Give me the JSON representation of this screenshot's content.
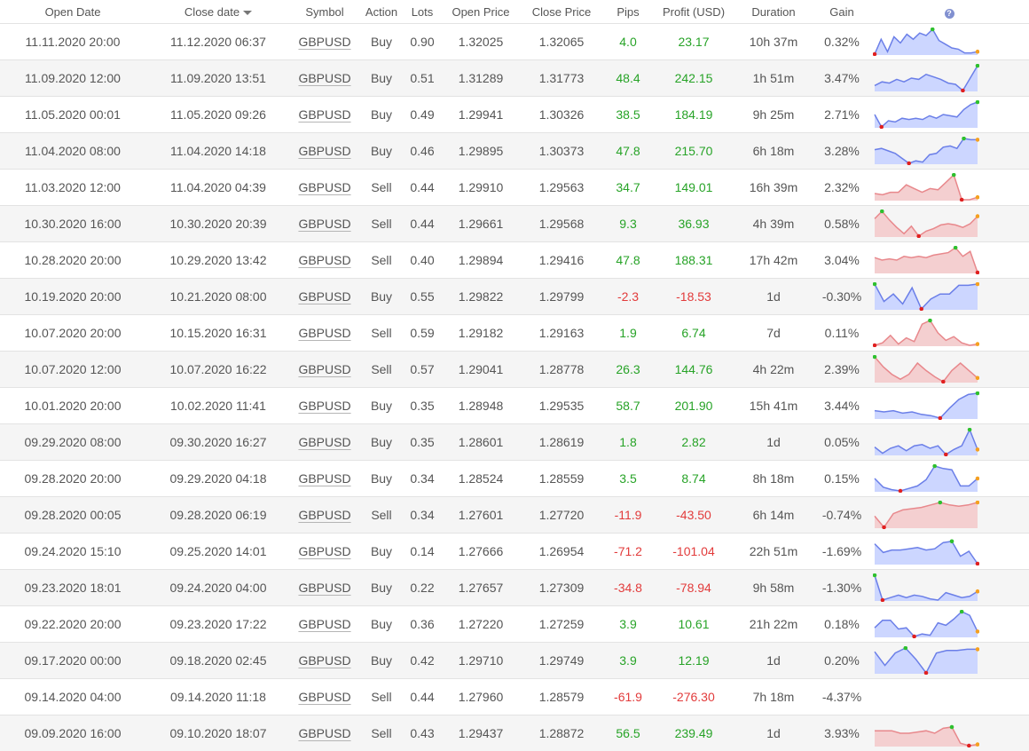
{
  "table": {
    "headers": {
      "open_date": "Open Date",
      "close_date": "Close date",
      "symbol": "Symbol",
      "action": "Action",
      "lots": "Lots",
      "open_price": "Open Price",
      "close_price": "Close Price",
      "pips": "Pips",
      "profit": "Profit (USD)",
      "duration": "Duration",
      "gain": "Gain",
      "help": "?"
    },
    "rows": [
      {
        "open_date": "11.11.2020 20:00",
        "close_date": "11.12.2020 06:37",
        "symbol": "GBPUSD",
        "action": "Buy",
        "lots": "0.90",
        "open_price": "1.32025",
        "close_price": "1.32065",
        "pips": "4.0",
        "profit": "23.17",
        "duration": "10h 37m",
        "gain": "0.32%",
        "trend": [
          0.0,
          0.6,
          0.1,
          0.7,
          0.45,
          0.8,
          0.6,
          0.85,
          0.75,
          1.0,
          0.55,
          0.4,
          0.25,
          0.2,
          0.05,
          0.05,
          0.1
        ]
      },
      {
        "open_date": "11.09.2020 12:00",
        "close_date": "11.09.2020 13:51",
        "symbol": "GBPUSD",
        "action": "Buy",
        "lots": "0.51",
        "open_price": "1.31289",
        "close_price": "1.31773",
        "pips": "48.4",
        "profit": "242.15",
        "duration": "1h 51m",
        "gain": "3.47%",
        "trend": [
          0.2,
          0.35,
          0.3,
          0.45,
          0.35,
          0.5,
          0.45,
          0.65,
          0.55,
          0.45,
          0.3,
          0.25,
          0.0,
          0.5,
          1.0
        ]
      },
      {
        "open_date": "11.05.2020 00:01",
        "close_date": "11.05.2020 09:26",
        "symbol": "GBPUSD",
        "action": "Buy",
        "lots": "0.49",
        "open_price": "1.29941",
        "close_price": "1.30326",
        "pips": "38.5",
        "profit": "184.19",
        "duration": "9h 25m",
        "gain": "2.71%",
        "trend": [
          0.5,
          0.0,
          0.25,
          0.2,
          0.35,
          0.3,
          0.35,
          0.3,
          0.45,
          0.35,
          0.5,
          0.45,
          0.4,
          0.7,
          0.9,
          1.0
        ]
      },
      {
        "open_date": "11.04.2020 08:00",
        "close_date": "11.04.2020 14:18",
        "symbol": "GBPUSD",
        "action": "Buy",
        "lots": "0.46",
        "open_price": "1.29895",
        "close_price": "1.30373",
        "pips": "47.8",
        "profit": "215.70",
        "duration": "6h 18m",
        "gain": "3.28%",
        "trend": [
          0.55,
          0.6,
          0.5,
          0.4,
          0.2,
          0.0,
          0.1,
          0.05,
          0.35,
          0.4,
          0.65,
          0.7,
          0.6,
          1.0,
          0.95,
          0.95
        ]
      },
      {
        "open_date": "11.03.2020 12:00",
        "close_date": "11.04.2020 04:39",
        "symbol": "GBPUSD",
        "action": "Sell",
        "lots": "0.44",
        "open_price": "1.29910",
        "close_price": "1.29563",
        "pips": "34.7",
        "profit": "149.01",
        "duration": "16h 39m",
        "gain": "2.32%",
        "trend": [
          0.25,
          0.2,
          0.3,
          0.3,
          0.6,
          0.45,
          0.3,
          0.45,
          0.4,
          0.7,
          1.0,
          0.0,
          0.0,
          0.1
        ]
      },
      {
        "open_date": "10.30.2020 16:00",
        "close_date": "10.30.2020 20:39",
        "symbol": "GBPUSD",
        "action": "Sell",
        "lots": "0.44",
        "open_price": "1.29661",
        "close_price": "1.29568",
        "pips": "9.3",
        "profit": "36.93",
        "duration": "4h 39m",
        "gain": "0.58%",
        "trend": [
          0.7,
          1.0,
          0.65,
          0.35,
          0.1,
          0.4,
          0.0,
          0.2,
          0.3,
          0.45,
          0.5,
          0.45,
          0.35,
          0.5,
          0.8
        ]
      },
      {
        "open_date": "10.28.2020 20:00",
        "close_date": "10.29.2020 13:42",
        "symbol": "GBPUSD",
        "action": "Sell",
        "lots": "0.40",
        "open_price": "1.29894",
        "close_price": "1.29416",
        "pips": "47.8",
        "profit": "188.31",
        "duration": "17h 42m",
        "gain": "3.04%",
        "trend": [
          0.6,
          0.5,
          0.55,
          0.5,
          0.65,
          0.6,
          0.65,
          0.6,
          0.7,
          0.75,
          0.8,
          1.0,
          0.65,
          0.85,
          0.0
        ]
      },
      {
        "open_date": "10.19.2020 20:00",
        "close_date": "10.21.2020 08:00",
        "symbol": "GBPUSD",
        "action": "Buy",
        "lots": "0.55",
        "open_price": "1.29822",
        "close_price": "1.29799",
        "pips": "-2.3",
        "profit": "-18.53",
        "duration": "1d",
        "gain": "-0.30%",
        "trend": [
          1.0,
          0.3,
          0.6,
          0.2,
          0.85,
          0.0,
          0.4,
          0.6,
          0.6,
          0.95,
          0.95,
          1.0
        ]
      },
      {
        "open_date": "10.07.2020 20:00",
        "close_date": "10.15.2020 16:31",
        "symbol": "GBPUSD",
        "action": "Sell",
        "lots": "0.59",
        "open_price": "1.29182",
        "close_price": "1.29163",
        "pips": "1.9",
        "profit": "6.74",
        "duration": "7d",
        "gain": "0.11%",
        "trend": [
          0.0,
          0.1,
          0.4,
          0.05,
          0.3,
          0.15,
          0.85,
          1.0,
          0.5,
          0.2,
          0.35,
          0.1,
          0.0,
          0.05
        ]
      },
      {
        "open_date": "10.07.2020 12:00",
        "close_date": "10.07.2020 16:22",
        "symbol": "GBPUSD",
        "action": "Sell",
        "lots": "0.57",
        "open_price": "1.29041",
        "close_price": "1.28778",
        "pips": "26.3",
        "profit": "144.76",
        "duration": "4h 22m",
        "gain": "2.39%",
        "trend": [
          1.0,
          0.6,
          0.3,
          0.1,
          0.3,
          0.75,
          0.45,
          0.2,
          0.0,
          0.45,
          0.75,
          0.45,
          0.15
        ]
      },
      {
        "open_date": "10.01.2020 20:00",
        "close_date": "10.02.2020 11:41",
        "symbol": "GBPUSD",
        "action": "Buy",
        "lots": "0.35",
        "open_price": "1.28948",
        "close_price": "1.29535",
        "pips": "58.7",
        "profit": "201.90",
        "duration": "15h 41m",
        "gain": "3.44%",
        "trend": [
          0.3,
          0.25,
          0.3,
          0.2,
          0.25,
          0.15,
          0.1,
          0.0,
          0.4,
          0.75,
          0.95,
          1.0
        ]
      },
      {
        "open_date": "09.29.2020 08:00",
        "close_date": "09.30.2020 16:27",
        "symbol": "GBPUSD",
        "action": "Buy",
        "lots": "0.35",
        "open_price": "1.28601",
        "close_price": "1.28619",
        "pips": "1.8",
        "profit": "2.82",
        "duration": "1d",
        "gain": "0.05%",
        "trend": [
          0.3,
          0.05,
          0.25,
          0.35,
          0.15,
          0.35,
          0.4,
          0.25,
          0.35,
          0.0,
          0.2,
          0.35,
          1.0,
          0.2
        ]
      },
      {
        "open_date": "09.28.2020 20:00",
        "close_date": "09.29.2020 04:18",
        "symbol": "GBPUSD",
        "action": "Buy",
        "lots": "0.34",
        "open_price": "1.28524",
        "close_price": "1.28559",
        "pips": "3.5",
        "profit": "8.74",
        "duration": "8h 18m",
        "gain": "0.15%",
        "trend": [
          0.5,
          0.15,
          0.05,
          0.0,
          0.1,
          0.2,
          0.45,
          1.0,
          0.9,
          0.85,
          0.2,
          0.2,
          0.5
        ]
      },
      {
        "open_date": "09.28.2020 00:05",
        "close_date": "09.28.2020 06:19",
        "symbol": "GBPUSD",
        "action": "Sell",
        "lots": "0.34",
        "open_price": "1.27601",
        "close_price": "1.27720",
        "pips": "-11.9",
        "profit": "-43.50",
        "duration": "6h 14m",
        "gain": "-0.74%",
        "trend": [
          0.45,
          0.0,
          0.55,
          0.7,
          0.75,
          0.8,
          0.9,
          1.0,
          0.9,
          0.85,
          0.9,
          1.0
        ]
      },
      {
        "open_date": "09.24.2020 15:10",
        "close_date": "09.25.2020 14:01",
        "symbol": "GBPUSD",
        "action": "Buy",
        "lots": "0.14",
        "open_price": "1.27666",
        "close_price": "1.26954",
        "pips": "-71.2",
        "profit": "-101.04",
        "duration": "22h 51m",
        "gain": "-1.69%",
        "trend": [
          0.8,
          0.45,
          0.55,
          0.55,
          0.6,
          0.65,
          0.55,
          0.6,
          0.85,
          0.9,
          0.3,
          0.5,
          0.0
        ]
      },
      {
        "open_date": "09.23.2020 18:01",
        "close_date": "09.24.2020 04:00",
        "symbol": "GBPUSD",
        "action": "Buy",
        "lots": "0.22",
        "open_price": "1.27657",
        "close_price": "1.27309",
        "pips": "-34.8",
        "profit": "-78.94",
        "duration": "9h 58m",
        "gain": "-1.30%",
        "trend": [
          1.0,
          0.0,
          0.1,
          0.2,
          0.1,
          0.2,
          0.15,
          0.05,
          0.0,
          0.3,
          0.2,
          0.1,
          0.15,
          0.35
        ]
      },
      {
        "open_date": "09.22.2020 20:00",
        "close_date": "09.23.2020 17:22",
        "symbol": "GBPUSD",
        "action": "Buy",
        "lots": "0.36",
        "open_price": "1.27220",
        "close_price": "1.27259",
        "pips": "3.9",
        "profit": "10.61",
        "duration": "21h 22m",
        "gain": "0.18%",
        "trend": [
          0.35,
          0.65,
          0.65,
          0.3,
          0.35,
          0.0,
          0.1,
          0.05,
          0.55,
          0.45,
          0.7,
          1.0,
          0.85,
          0.2
        ]
      },
      {
        "open_date": "09.17.2020 00:00",
        "close_date": "09.18.2020 02:45",
        "symbol": "GBPUSD",
        "action": "Buy",
        "lots": "0.42",
        "open_price": "1.29710",
        "close_price": "1.29749",
        "pips": "3.9",
        "profit": "12.19",
        "duration": "1d",
        "gain": "0.20%",
        "trend": [
          0.85,
          0.3,
          0.8,
          1.0,
          0.55,
          0.0,
          0.8,
          0.9,
          0.9,
          0.95,
          0.95
        ]
      },
      {
        "open_date": "09.14.2020 04:00",
        "close_date": "09.14.2020 11:18",
        "symbol": "GBPUSD",
        "action": "Sell",
        "lots": "0.44",
        "open_price": "1.27960",
        "close_price": "1.28579",
        "pips": "-61.9",
        "profit": "-276.30",
        "duration": "7h 18m",
        "gain": "-4.37%",
        "trend": []
      },
      {
        "open_date": "09.09.2020 16:00",
        "close_date": "09.10.2020 18:07",
        "symbol": "GBPUSD",
        "action": "Sell",
        "lots": "0.43",
        "open_price": "1.29437",
        "close_price": "1.28872",
        "pips": "56.5",
        "profit": "239.49",
        "duration": "1d",
        "gain": "3.93%",
        "trend": [
          0.6,
          0.6,
          0.6,
          0.5,
          0.5,
          0.55,
          0.6,
          0.5,
          0.7,
          0.75,
          0.1,
          0.0,
          0.05
        ]
      }
    ]
  },
  "colors": {
    "buy_line": "#6b7fe8",
    "buy_fill": "#ccd6ff",
    "sell_line": "#e8888c",
    "sell_fill": "#f4cfd0",
    "max_dot": "#2ec02e",
    "min_dot": "#e02020",
    "end_dot": "#f5a020",
    "positive": "#27a327",
    "negative": "#e23b3b"
  }
}
